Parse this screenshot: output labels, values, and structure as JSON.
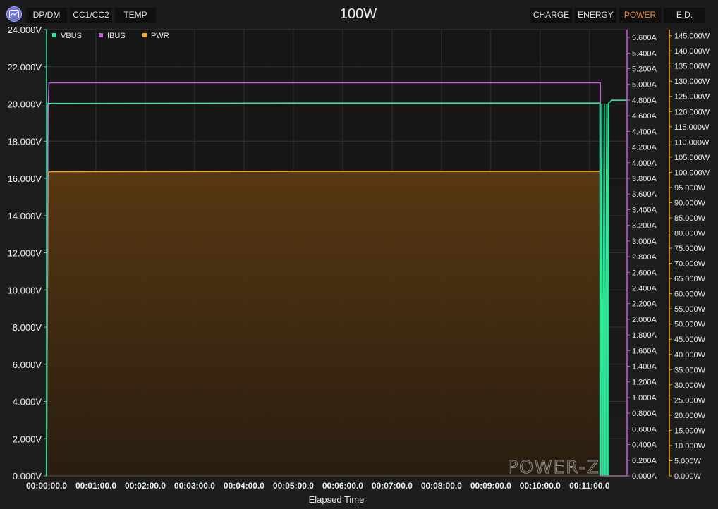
{
  "toolbar": {
    "left_buttons": [
      "DP/DM",
      "CC1/CC2",
      "TEMP"
    ],
    "title": "100W",
    "right_buttons": [
      "CHARGE",
      "ENERGY",
      "POWER",
      "E.D."
    ],
    "active_button": "POWER"
  },
  "watermark": "POWER-Z",
  "colors": {
    "vbus": "#2ee89a",
    "ibus": "#c45ee0",
    "pwr": "#f5a623",
    "pwr_fill": "#7a5218",
    "axis_left": "#2ee89a",
    "axis_mid": "#c45ee0",
    "axis_right": "#f5a623",
    "active_button": "#f08b3a"
  },
  "chart_data": {
    "type": "line",
    "xlabel": "Elapsed Time",
    "x_ticks": [
      "00:00:00.0",
      "00:01:00.0",
      "00:02:00.0",
      "00:03:00.0",
      "00:04:00.0",
      "00:05:00.0",
      "00:06:00.0",
      "00:07:00.0",
      "00:08:00.0",
      "00:09:00.0",
      "00:10:00.0",
      "00:11:00.0"
    ],
    "x_unit": "minutes",
    "x_range": [
      0,
      11.76
    ],
    "legend": [
      "VBUS",
      "IBUS",
      "PWR"
    ],
    "legend_position": "top-left",
    "grid": true,
    "axes": {
      "left": {
        "label": "VBUS",
        "range": [
          0,
          24
        ],
        "ticks": [
          "0.000V",
          "2.000V",
          "4.000V",
          "6.000V",
          "8.000V",
          "10.000V",
          "12.000V",
          "14.000V",
          "16.000V",
          "18.000V",
          "20.000V",
          "22.000V",
          "24.000V"
        ]
      },
      "mid": {
        "label": "IBUS",
        "range": [
          0,
          5.7
        ],
        "ticks": [
          "0.000A",
          "0.200A",
          "0.400A",
          "0.600A",
          "0.800A",
          "1.000A",
          "1.200A",
          "1.400A",
          "1.600A",
          "1.800A",
          "2.000A",
          "2.200A",
          "2.400A",
          "2.600A",
          "2.800A",
          "3.000A",
          "3.200A",
          "3.400A",
          "3.600A",
          "3.800A",
          "4.000A",
          "4.200A",
          "4.400A",
          "4.600A",
          "4.800A",
          "5.000A",
          "5.200A",
          "5.400A",
          "5.600A"
        ]
      },
      "right": {
        "label": "PWR",
        "range": [
          0,
          147
        ],
        "ticks": [
          "0.000W",
          "5.000W",
          "10.000W",
          "15.000W",
          "20.000W",
          "25.000W",
          "30.000W",
          "35.000W",
          "40.000W",
          "45.000W",
          "50.000W",
          "55.000W",
          "60.000W",
          "65.000W",
          "70.000W",
          "75.000W",
          "80.000W",
          "85.000W",
          "90.000W",
          "95.000W",
          "100.000W",
          "105.000W",
          "110.000W",
          "115.000W",
          "120.000W",
          "125.000W",
          "130.000W",
          "135.000W",
          "140.000W",
          "145.000W"
        ]
      }
    },
    "series": [
      {
        "name": "VBUS",
        "unit": "V",
        "x": [
          0,
          0.01,
          0.03,
          5.0,
          11.2,
          11.21,
          11.22,
          11.25,
          11.26,
          11.3,
          11.31,
          11.35,
          11.36,
          11.38,
          11.4,
          11.41,
          11.45,
          11.76
        ],
        "y": [
          0,
          20.0,
          20.03,
          20.05,
          20.05,
          20.05,
          0,
          20.0,
          0,
          20.0,
          0,
          20.0,
          0,
          20.0,
          20.1,
          20.1,
          20.2,
          20.2
        ]
      },
      {
        "name": "IBUS",
        "unit": "A",
        "x": [
          0,
          0.03,
          0.05,
          5.0,
          11.22,
          11.23,
          11.76
        ],
        "y": [
          0,
          4.64,
          5.02,
          5.02,
          5.02,
          0,
          0
        ]
      },
      {
        "name": "PWR",
        "unit": "W",
        "x": [
          0,
          0.03,
          0.05,
          5.0,
          11.22,
          11.23,
          11.76
        ],
        "y": [
          0,
          98.5,
          100.2,
          100.3,
          100.3,
          0,
          0
        ]
      }
    ]
  }
}
